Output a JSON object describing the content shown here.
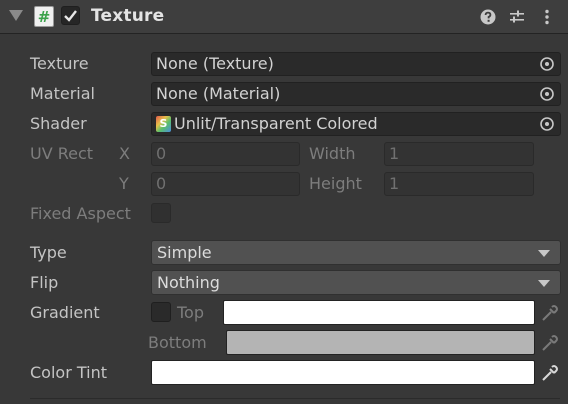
{
  "header": {
    "title": "Texture",
    "enabled": true,
    "icons": [
      "foldout-arrow-icon",
      "script-icon",
      "help-icon",
      "presets-icon",
      "more-icon"
    ]
  },
  "properties": {
    "texture": {
      "label": "Texture",
      "value": "None (Texture)"
    },
    "material": {
      "label": "Material",
      "value": "None (Material)"
    },
    "shader": {
      "label": "Shader",
      "value": "Unlit/Transparent Colored"
    },
    "uv_rect": {
      "label": "UV Rect",
      "x_label": "X",
      "x_value": "0",
      "y_label": "Y",
      "y_value": "0",
      "width_label": "Width",
      "width_value": "1",
      "height_label": "Height",
      "height_value": "1"
    },
    "fixed_aspect": {
      "label": "Fixed Aspect",
      "checked": false
    },
    "type": {
      "label": "Type",
      "value": "Simple"
    },
    "flip": {
      "label": "Flip",
      "value": "Nothing"
    },
    "gradient": {
      "label": "Gradient",
      "checked": false,
      "top_label": "Top",
      "top_color": "#ffffff",
      "bottom_label": "Bottom",
      "bottom_color": "#b4b4b4"
    },
    "color_tint": {
      "label": "Color Tint",
      "color": "#ffffff"
    }
  }
}
